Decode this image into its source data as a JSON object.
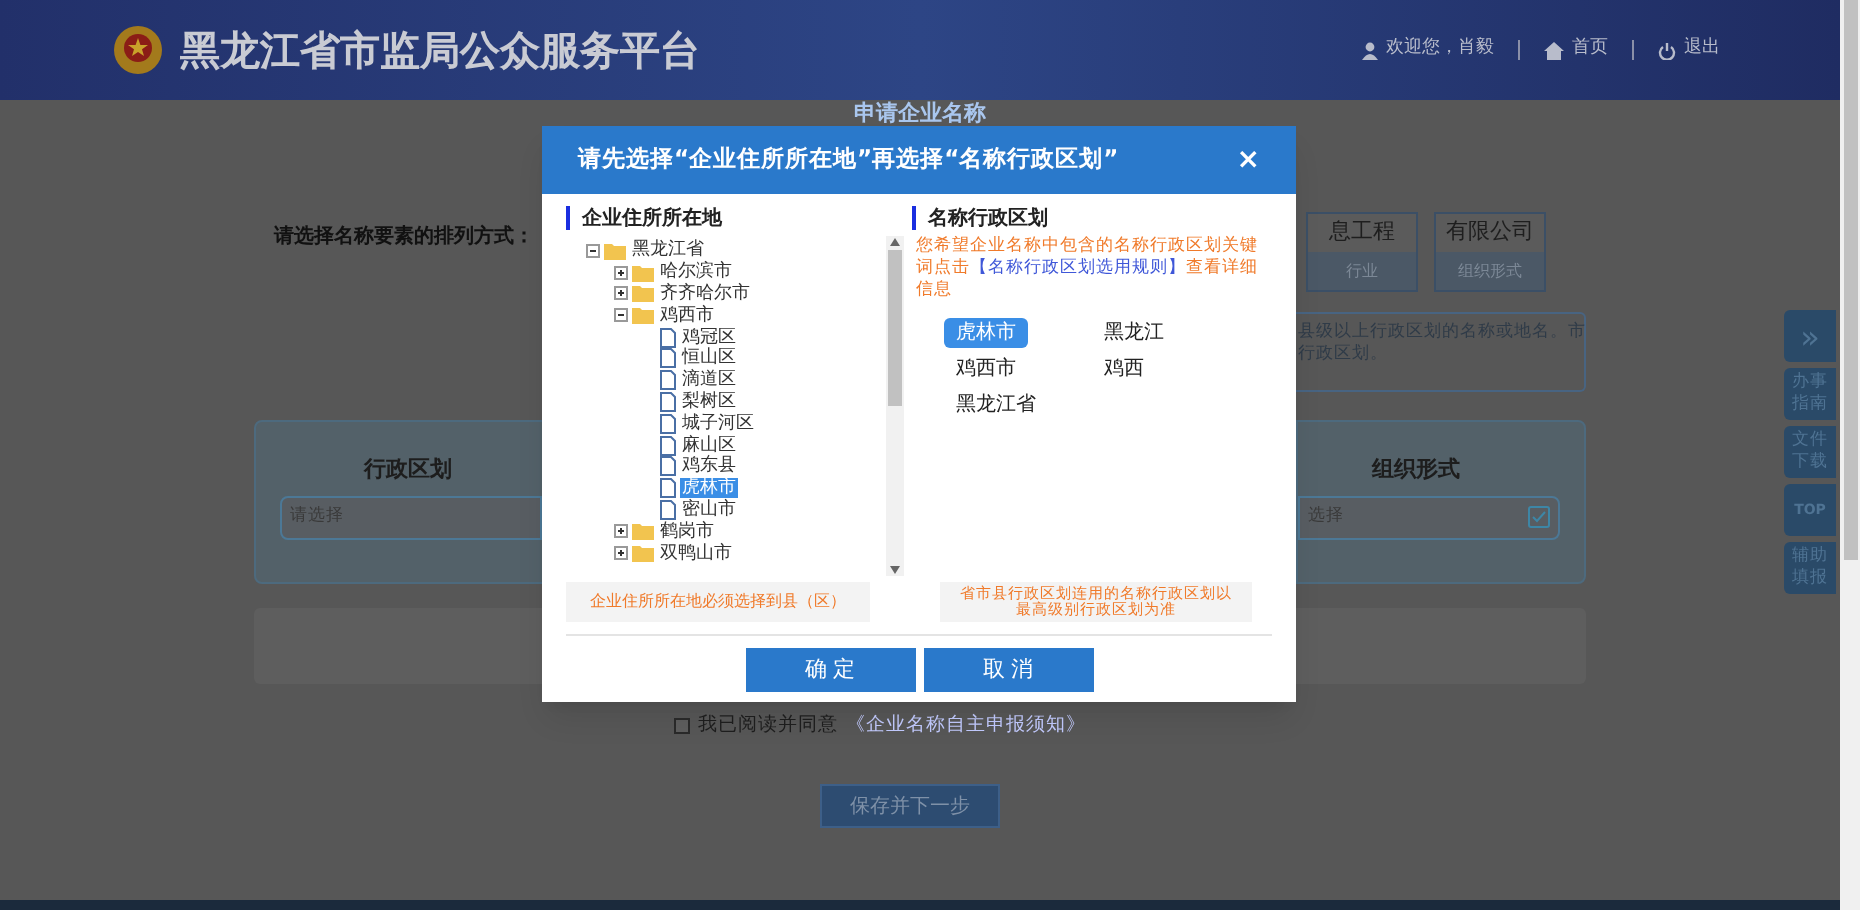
{
  "header": {
    "title": "黑龙江省市监局公众服务平台",
    "user": "欢迎您，肖毅",
    "links": [
      {
        "kind": "home",
        "label": "首页"
      },
      {
        "kind": "logout",
        "label": "退出"
      }
    ]
  },
  "page": {
    "title": "申请企业名称",
    "order_label": "请选择名称要素的排列方式：",
    "elements": [
      {
        "value": "息工程",
        "type": "行业"
      },
      {
        "value": "有限公司",
        "type": "组织形式"
      }
    ],
    "note_lines": [
      "县级以上行政区划的名称或地名。市",
      "行政区划。"
    ],
    "fields": [
      {
        "label": "行政区划",
        "placeholder": "请选择"
      },
      {
        "label": "组织形式",
        "placeholder": "选择"
      }
    ],
    "agree": {
      "checked": false,
      "text": "我已阅读并同意",
      "link": "《企业名称自主申报须知》"
    },
    "next_button": "保存并下一步"
  },
  "side_tools": [
    {
      "kind": "expand",
      "label": "»"
    },
    {
      "kind": "text",
      "label": "办事指南"
    },
    {
      "kind": "text",
      "label": "文件下载"
    },
    {
      "kind": "top",
      "label": "TOP"
    },
    {
      "kind": "text",
      "label": "辅助填报"
    }
  ],
  "dialog": {
    "title": "请先选择“企业住所所在地”再选择“名称行政区划”",
    "close": "×",
    "left_heading": "企业住所所在地",
    "tree": [
      {
        "label": "黑龙江省",
        "expanded": true,
        "selected": false,
        "children": [
          {
            "label": "哈尔滨市",
            "expanded": false,
            "selected": false
          },
          {
            "label": "齐齐哈尔市",
            "expanded": false,
            "selected": false
          },
          {
            "label": "鸡西市",
            "expanded": true,
            "selected": false,
            "children": [
              {
                "label": "鸡冠区",
                "selected": false
              },
              {
                "label": "恒山区",
                "selected": false
              },
              {
                "label": "滴道区",
                "selected": false
              },
              {
                "label": "梨树区",
                "selected": false
              },
              {
                "label": "城子河区",
                "selected": false
              },
              {
                "label": "麻山区",
                "selected": false
              },
              {
                "label": "鸡东县",
                "selected": false
              },
              {
                "label": "虎林市",
                "selected": true
              },
              {
                "label": "密山市",
                "selected": false
              }
            ]
          },
          {
            "label": "鹤岗市",
            "expanded": false,
            "selected": false
          },
          {
            "label": "双鸭山市",
            "expanded": false,
            "selected": false
          }
        ]
      }
    ],
    "right_heading": "名称行政区划",
    "hint_before": "您希望企业名称中包含的名称行政区划关键词点击",
    "hint_link": "【名称行政区划选用规则】",
    "hint_after": "查看详细信息",
    "options": [
      {
        "label": "虎林市",
        "selected": true
      },
      {
        "label": "黑龙江",
        "selected": false
      },
      {
        "label": "鸡西市",
        "selected": false
      },
      {
        "label": "鸡西",
        "selected": false
      },
      {
        "label": "黑龙江省",
        "selected": false
      }
    ],
    "left_note": "企业住所所在地必须选择到县（区）",
    "right_note": "省市县行政区划连用的名称行政区划以最高级别行政区划为准",
    "buttons": [
      "确 定",
      "取 消"
    ]
  }
}
